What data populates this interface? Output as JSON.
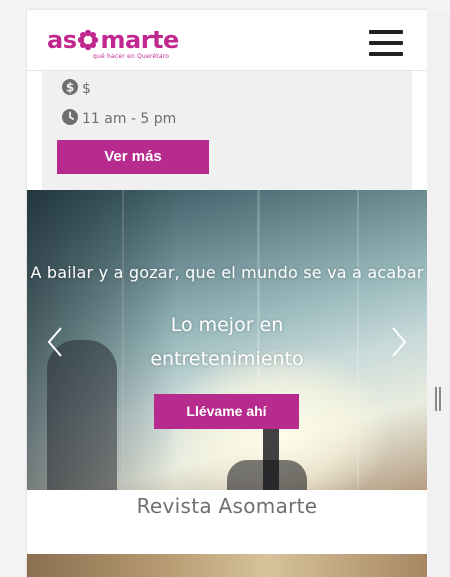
{
  "header": {
    "logo_text_before": "as",
    "logo_text_after": "marte",
    "logo_tagline": "qué hacer en Querétaro",
    "menu_icon": "hamburger-menu-icon",
    "brand_color": "#c0288f"
  },
  "event": {
    "price_icon": "dollar-circle-icon",
    "price": "$",
    "time_icon": "clock-icon",
    "time": "11 am - 5 pm",
    "button_label": "Ver más"
  },
  "carousel": {
    "subtitle": "A bailar y a gozar, que el mundo se va a acabar",
    "title": "Lo mejor en entretenimiento",
    "button_label": "Llévame ahí",
    "prev_icon": "chevron-left-icon",
    "next_icon": "chevron-right-icon"
  },
  "section": {
    "title": "Revista Asomarte"
  },
  "colors": {
    "accent": "#b72a8e",
    "card_background": "#f0f0f0"
  }
}
